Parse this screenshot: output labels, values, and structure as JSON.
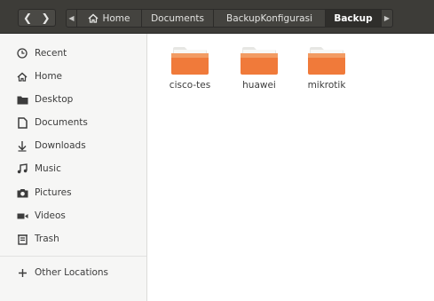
{
  "header": {
    "nav_back_icon": "chevron-left-icon",
    "nav_forward_icon": "chevron-right-icon",
    "breadcrumb": [
      {
        "label": "Home",
        "icon": "home-icon"
      },
      {
        "label": "Documents"
      },
      {
        "label": "BackupKonfigurasi"
      },
      {
        "label": "Backup",
        "current": true
      }
    ]
  },
  "sidebar": {
    "items": [
      {
        "label": "Recent",
        "icon": "clock-icon"
      },
      {
        "label": "Home",
        "icon": "home-icon"
      },
      {
        "label": "Desktop",
        "icon": "desktop-icon"
      },
      {
        "label": "Documents",
        "icon": "document-icon"
      },
      {
        "label": "Downloads",
        "icon": "download-icon"
      },
      {
        "label": "Music",
        "icon": "music-icon"
      },
      {
        "label": "Pictures",
        "icon": "camera-icon"
      },
      {
        "label": "Videos",
        "icon": "video-icon"
      },
      {
        "label": "Trash",
        "icon": "trash-icon"
      }
    ],
    "other_locations": {
      "label": "Other Locations",
      "icon": "plus-icon"
    }
  },
  "main": {
    "folders": [
      {
        "name": "cisco-tes"
      },
      {
        "name": "huawei"
      },
      {
        "name": "mikrotik"
      }
    ]
  },
  "colors": {
    "header_bg": "#3d3c38",
    "sidebar_bg": "#f6f6f5",
    "folder_orange": "#f07a3a",
    "folder_top": "#f29b63"
  }
}
